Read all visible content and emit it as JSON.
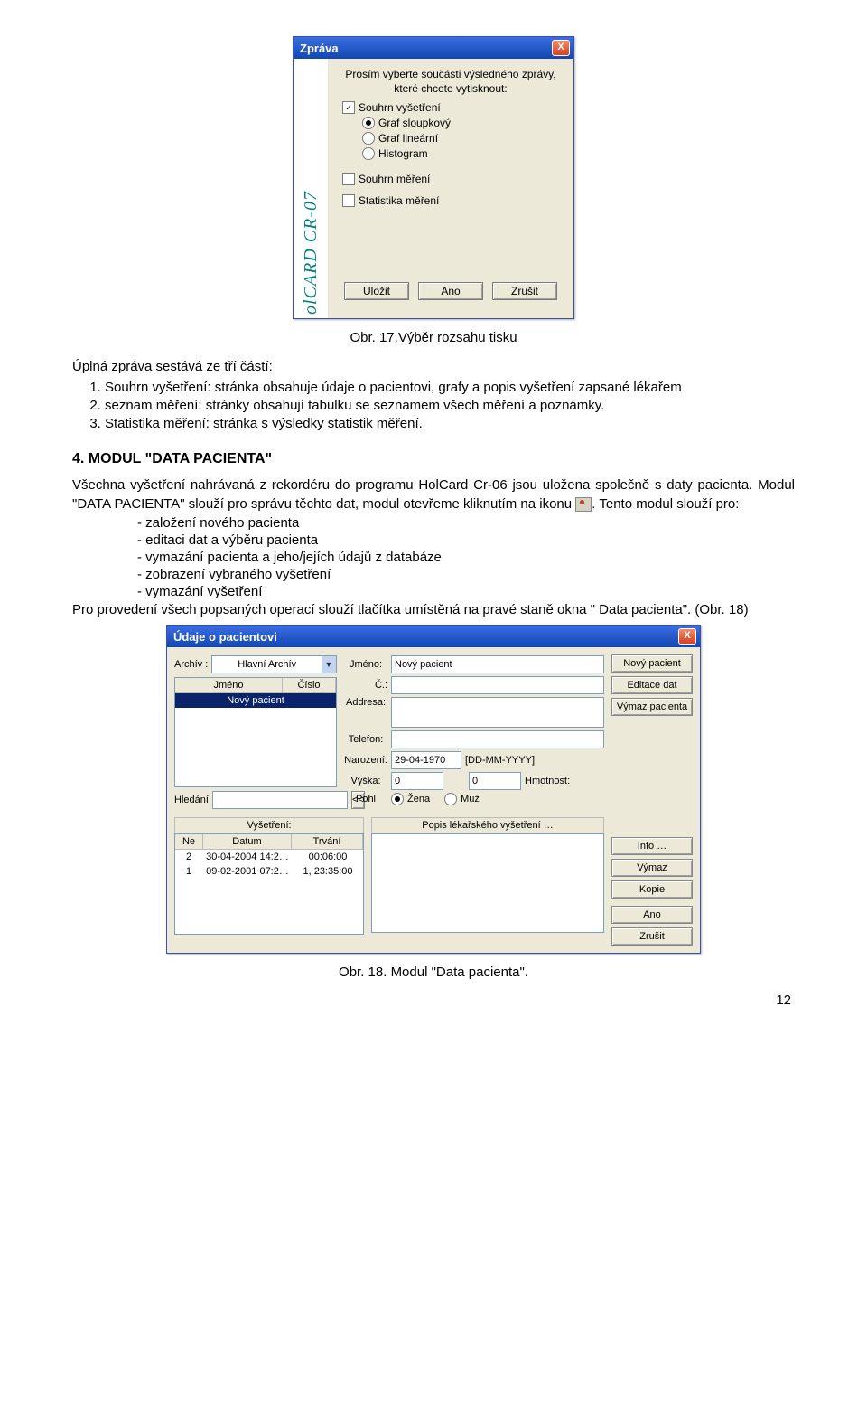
{
  "dialog1": {
    "title": "Zpráva",
    "logo": "olCARD CR-07",
    "prompt": "Prosím vyberte součásti výsledného zprávy, které chcete vytisknout:",
    "check_souhrn_vys": "Souhrn vyšetření",
    "radio_graf_sloup": "Graf sloupkový",
    "radio_graf_lin": "Graf lineární",
    "radio_histogram": "Histogram",
    "check_souhrn_mer": "Souhrn měření",
    "check_stat_mer": "Statistika měření",
    "btn_save": "Uložit",
    "btn_yes": "Ano",
    "btn_cancel": "Zrušit"
  },
  "caption1": "Obr. 17.Výběr rozsahu tisku",
  "para1": "Úplná zpráva sestává ze tří částí:",
  "list_items": {
    "i1": "Souhrn vyšetření: stránka obsahuje údaje o pacientovi, grafy a popis vyšetření zapsané lékařem",
    "i2": "seznam měření: stránky obsahují tabulku se seznamem všech měření a poznámky.",
    "i3": "Statistika měření: stránka s výsledky statistik měření."
  },
  "section_heading": "4.   MODUL \"DATA PACIENTA\"",
  "para2a": "Všechna vyšetření nahrávaná z rekordéru do programu HolCard Cr-06 jsou uložena společně s  daty pacienta. Modul \"DATA PACIENTA\" slouží pro správu těchto dat, modul otevřeme kliknutím na ikonu ",
  "para2b": ". Tento modul slouží pro:",
  "bullets": {
    "b1": "založení nového pacienta",
    "b2": "editaci dat a výběru pacienta",
    "b3": "vymazání pacienta a jeho/jejích údajů z databáze",
    "b4": "zobrazení vybraného vyšetření",
    "b5": "vymazání vyšetření"
  },
  "para3": "Pro provedení všech popsaných operací slouží tlačítka umístěná na pravé staně okna \" Data pacienta\". (Obr. 18)",
  "dialog2": {
    "title": "Údaje o pacientovi",
    "label_archiv": "Archív :",
    "archiv_value": "Hlavní Archív",
    "patient_list_head": {
      "jmeno": "Jméno",
      "cislo": "Číslo"
    },
    "patient_list_row": "Nový pacient",
    "label_hledani": "Hledání",
    "btn_back": "<<",
    "lbl_jmeno": "Jméno:",
    "val_jmeno": "Nový pacient",
    "lbl_c": "Č.:",
    "lbl_adresa": "Addresa:",
    "lbl_telefon": "Telefon:",
    "lbl_narozeni": "Narození:",
    "val_narozeni": "29-04-1970",
    "narozeni_fmt": "[DD-MM-YYYY]",
    "lbl_vyska": "Výška:",
    "val_vyska": "0",
    "val_hmot": "0",
    "lbl_hmot": "Hmotnost:",
    "lbl_pohl": "Pohl",
    "radio_zena": "Žena",
    "radio_muz": "Muž",
    "btn_novy": "Nový pacient",
    "btn_edit": "Editace dat",
    "btn_vymazp": "Výmaz pacienta",
    "exam_head_label": "Vyšetření:",
    "exam_head": {
      "ne": "Ne",
      "datum": "Datum",
      "trvani": "Trvání"
    },
    "exam_rows": [
      {
        "ne": "2",
        "datum": "30-04-2004  14:2…",
        "trvani": "00:06:00"
      },
      {
        "ne": "1",
        "datum": "09-02-2001  07:2…",
        "trvani": "1, 23:35:00"
      }
    ],
    "desc_label": "Popis lékařského vyšetření …",
    "btn_info": "Info …",
    "btn_vymaz": "Výmaz",
    "btn_kopie": "Kopie",
    "btn_ano": "Ano",
    "btn_zrusit": "Zrušit"
  },
  "caption2": "Obr. 18. Modul \"Data pacienta\".",
  "page_number": "12"
}
